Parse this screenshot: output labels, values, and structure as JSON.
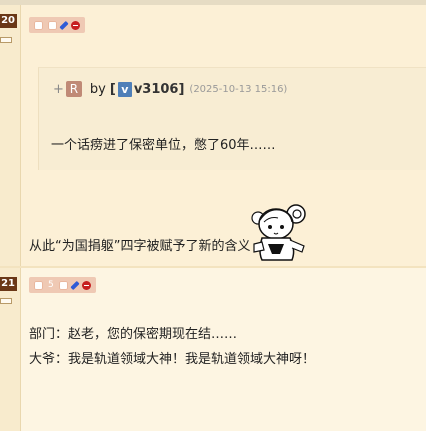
{
  "posts": [
    {
      "floor": "20",
      "quote": {
        "plus": "+",
        "r_button": "R",
        "by": "by",
        "user_open": "[",
        "user_badge": "v",
        "user_name": "v3106]",
        "date": "(2025-10-13 15:16)",
        "text": "一个话痨进了保密单位，憋了60年……"
      },
      "text": "从此“为国捐躯”四字被赋予了新的含义",
      "sticker": "mascot-sticker"
    },
    {
      "floor": "21",
      "toolbar_count": "5",
      "lines": [
        "部门：赵老，您的保密期现在结……",
        "大爷：我是轨道领域大神！我是轨道领域大神呀！"
      ]
    }
  ],
  "colors": {
    "background": "#fdf3dc",
    "floor_badge": "#6a3717",
    "toolbar": "#efc9b4",
    "user_badge": "#4f7fb8"
  }
}
